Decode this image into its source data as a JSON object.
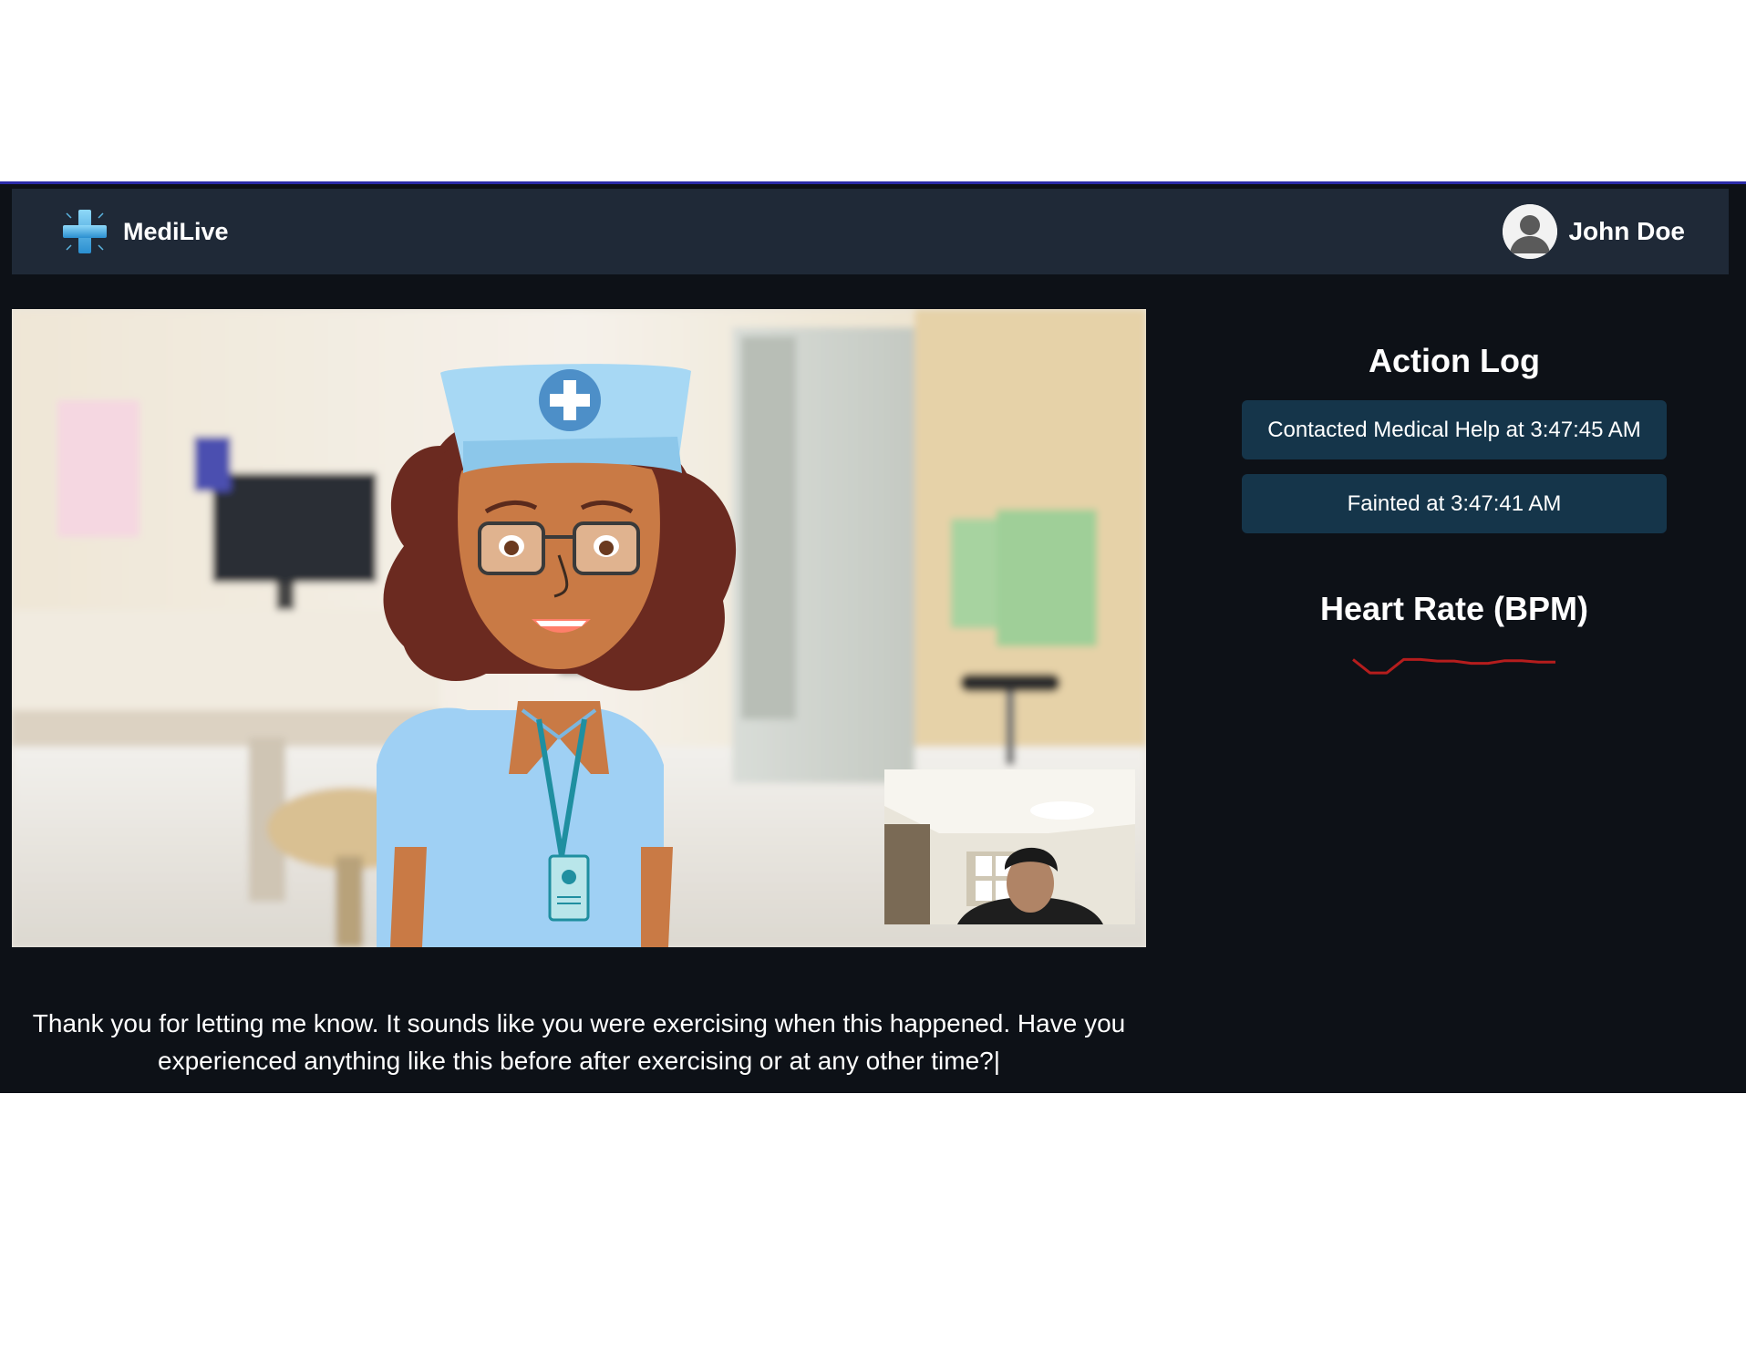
{
  "app": {
    "name": "MediLive",
    "logo_icon": "medical-cross-icon",
    "accent_color": "#2b2ba8",
    "background_color": "#0d1117",
    "navbar_color": "#1f2937"
  },
  "user": {
    "name": "John Doe",
    "avatar_icon": "user-avatar-icon"
  },
  "video": {
    "caption": "Thank you for letting me know. It sounds like you were exercising when this happened. Have you experienced anything like this before after exercising or at any other time?|"
  },
  "action_log": {
    "title": "Action Log",
    "item_color": "#15354a",
    "items": [
      {
        "text": "Contacted Medical Help at 3:47:45 AM"
      },
      {
        "text": "Fainted at 3:47:41 AM"
      }
    ]
  },
  "heart_rate": {
    "title": "Heart Rate (BPM)",
    "line_color": "#b51d1d"
  },
  "chart_data": {
    "type": "line",
    "title": "Heart Rate (BPM)",
    "xlabel": "",
    "ylabel": "",
    "grid": false,
    "ylim": [
      0,
      100
    ],
    "series": [
      {
        "values": [
          80,
          45,
          45,
          80,
          80,
          76,
          76,
          70,
          70,
          77,
          77,
          73,
          73
        ]
      }
    ]
  }
}
